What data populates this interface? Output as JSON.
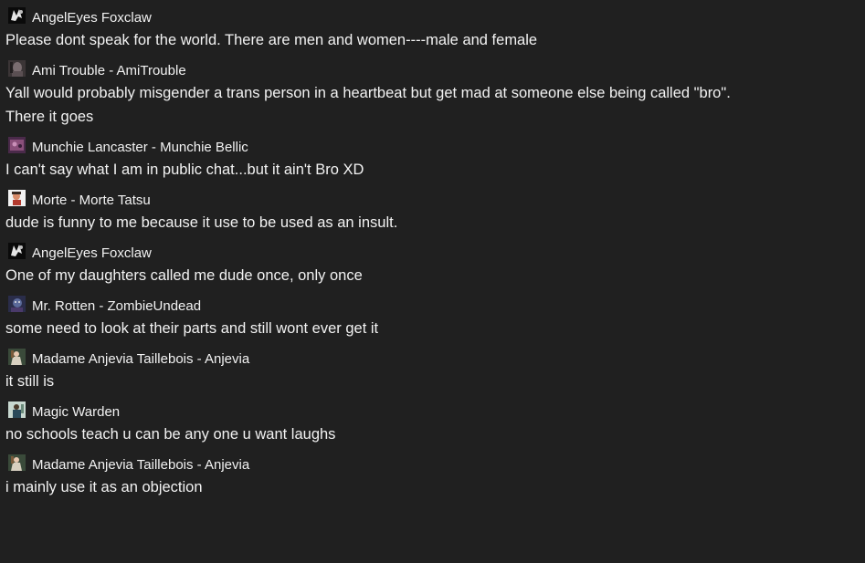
{
  "messages": [
    {
      "author": "AngelEyes Foxclaw",
      "avatar": "angeleyes-avatar-icon",
      "text": "Please dont speak for the world. There are men and women----male and female"
    },
    {
      "author": "Ami Trouble - AmiTrouble",
      "avatar": "ami-avatar-icon",
      "text": "Yall would probably misgender a trans person in a heartbeat but get mad at someone else being called \"bro\".\nThere it goes"
    },
    {
      "author": "Munchie Lancaster - Munchie Bellic",
      "avatar": "munchie-avatar-icon",
      "text": "I can't say what I am in public chat...but it ain't Bro XD"
    },
    {
      "author": "Morte - Morte Tatsu",
      "avatar": "morte-avatar-icon",
      "text": "dude is funny to me because it use to be used as an insult."
    },
    {
      "author": "AngelEyes Foxclaw",
      "avatar": "angeleyes-avatar-icon",
      "text": "One of my daughters called me dude once, only once"
    },
    {
      "author": "Mr. Rotten - ZombieUndead",
      "avatar": "rotten-avatar-icon",
      "text": "some need to look at their parts and still wont ever get it"
    },
    {
      "author": "Madame Anjevia Taillebois - Anjevia",
      "avatar": "anjevia-avatar-icon",
      "text": "it still is"
    },
    {
      "author": "Magic Warden",
      "avatar": "warden-avatar-icon",
      "text": "no schools teach u can be any one u want laughs"
    },
    {
      "author": "Madame Anjevia Taillebois - Anjevia",
      "avatar": "anjevia-avatar-icon",
      "text": "i mainly use it as an objection"
    }
  ]
}
